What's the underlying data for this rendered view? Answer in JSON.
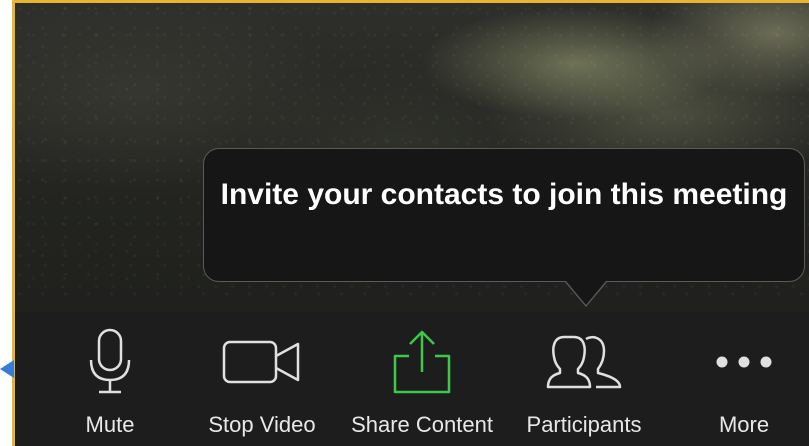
{
  "tooltip": {
    "text": "Invite your contacts to join this meeting"
  },
  "toolbar": {
    "items": [
      {
        "label": "Mute",
        "icon": "microphone-icon"
      },
      {
        "label": "Stop Video",
        "icon": "video-camera-icon"
      },
      {
        "label": "Share Content",
        "icon": "share-upload-icon"
      },
      {
        "label": "Participants",
        "icon": "participants-icon"
      },
      {
        "label": "More",
        "icon": "more-dots-icon"
      }
    ]
  },
  "colors": {
    "frame": "#e7b533",
    "toolbar_bg": "#1d1d1d",
    "share_accent": "#3cc84a",
    "icon_stroke": "#e0e0e0",
    "side_arrow": "#3a7bd5"
  }
}
